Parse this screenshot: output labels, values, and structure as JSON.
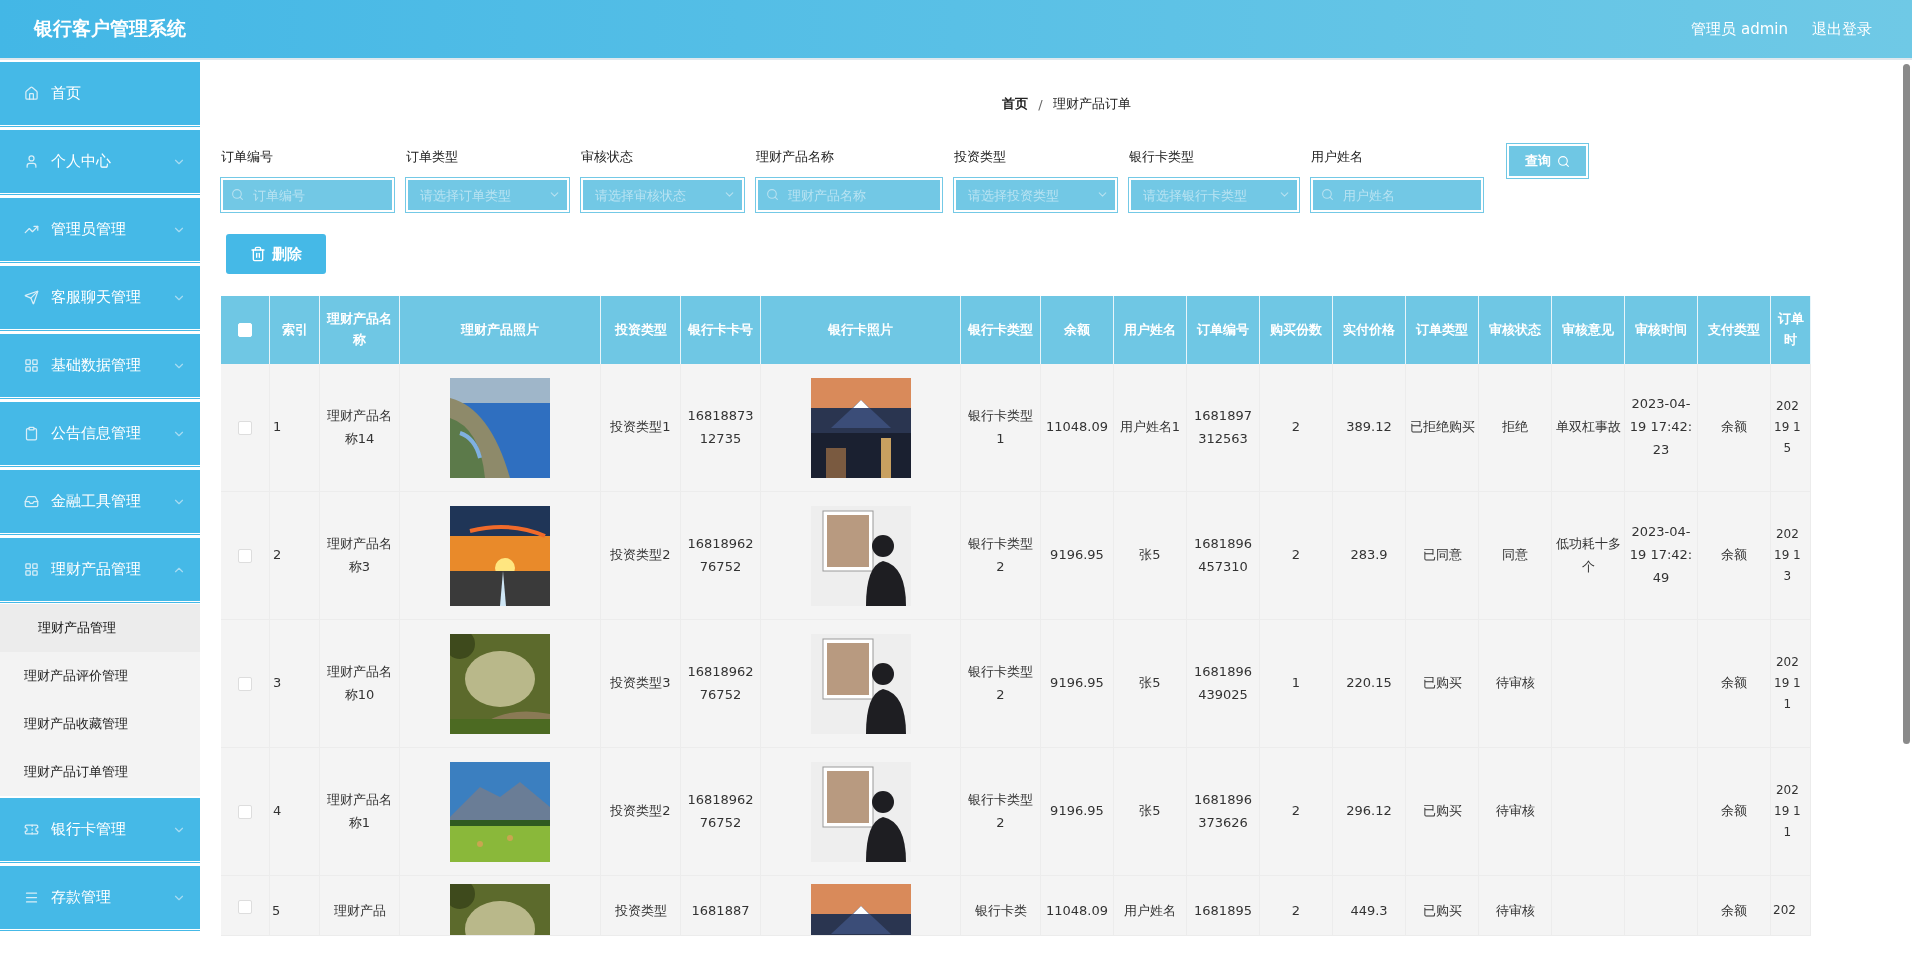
{
  "header": {
    "title": "银行客户管理系统",
    "user": "管理员 admin",
    "logout": "退出登录"
  },
  "sidebar": {
    "items": [
      {
        "label": "首页",
        "expandable": false
      },
      {
        "label": "个人中心",
        "expandable": true,
        "expanded": false
      },
      {
        "label": "管理员管理",
        "expandable": true,
        "expanded": false
      },
      {
        "label": "客服聊天管理",
        "expandable": true,
        "expanded": false
      },
      {
        "label": "基础数据管理",
        "expandable": true,
        "expanded": false
      },
      {
        "label": "公告信息管理",
        "expandable": true,
        "expanded": false
      },
      {
        "label": "金融工具管理",
        "expandable": true,
        "expanded": false
      },
      {
        "label": "理财产品管理",
        "expandable": true,
        "expanded": true,
        "children": [
          {
            "label": "理财产品管理",
            "selected": true
          },
          {
            "label": "理财产品评价管理",
            "selected": false
          },
          {
            "label": "理财产品收藏管理",
            "selected": false
          },
          {
            "label": "理财产品订单管理",
            "selected": false
          }
        ]
      },
      {
        "label": "银行卡管理",
        "expandable": true,
        "expanded": false
      },
      {
        "label": "存款管理",
        "expandable": true,
        "expanded": false
      }
    ]
  },
  "breadcrumb": {
    "items": [
      "首页",
      "理财产品订单"
    ],
    "separator": "/"
  },
  "filters": [
    {
      "label": "订单编号",
      "placeholder": "订单编号",
      "kind": "text"
    },
    {
      "label": "订单类型",
      "placeholder": "请选择订单类型",
      "kind": "select"
    },
    {
      "label": "审核状态",
      "placeholder": "请选择审核状态",
      "kind": "select"
    },
    {
      "label": "理财产品名称",
      "placeholder": "理财产品名称",
      "kind": "text"
    },
    {
      "label": "投资类型",
      "placeholder": "请选择投资类型",
      "kind": "select"
    },
    {
      "label": "银行卡类型",
      "placeholder": "请选择银行卡类型",
      "kind": "select"
    },
    {
      "label": "用户姓名",
      "placeholder": "用户姓名",
      "kind": "text"
    }
  ],
  "search_button": "查询",
  "delete_button": "删除",
  "table": {
    "select_all": {
      "checked": false
    },
    "columns": [
      {
        "label": "索引",
        "kind": "text"
      },
      {
        "label": "理财产品名称",
        "kind": "text"
      },
      {
        "label": "理财产品照片"
      },
      {
        "label": "投资类型",
        "kind": "text"
      },
      {
        "label": "银行卡卡号",
        "kind": "text"
      },
      {
        "label": "银行卡照片"
      },
      {
        "label": "银行卡类型",
        "kind": "text"
      },
      {
        "label": "余额",
        "kind": "text"
      },
      {
        "label": "用户姓名",
        "kind": "text"
      },
      {
        "label": "订单编号",
        "kind": "text"
      },
      {
        "label": "购买份数",
        "kind": "text"
      },
      {
        "label": "实付价格",
        "kind": "text"
      },
      {
        "label": "订单类型",
        "kind": "text"
      },
      {
        "label": "审核状态",
        "kind": "text"
      },
      {
        "label": "审核意见",
        "kind": "text"
      },
      {
        "label": "审核时间",
        "kind": "text"
      },
      {
        "label": "支付类型",
        "kind": "text"
      },
      {
        "label": "订单时",
        "kind": "cut"
      }
    ],
    "rows": [
      {
        "selected": false,
        "cells": [
          "1",
          "理财产品名称14",
          "",
          "投资类型1",
          "1681887312735",
          "",
          "银行卡类型1",
          "11048.09",
          "用户姓名1",
          "1681897312563",
          "2",
          "389.12",
          "已拒绝购买",
          "拒绝",
          "单双杠事故",
          "2023-04-19 17:42:23",
          "余额",
          "202\n19 1\n5"
        ]
      },
      {
        "selected": false,
        "cells": [
          "2",
          "理财产品名称3",
          "",
          "投资类型2",
          "1681896276752",
          "",
          "银行卡类型2",
          "9196.95",
          "张5",
          "1681896457310",
          "2",
          "283.9",
          "已同意",
          "同意",
          "低功耗十多个",
          "2023-04-19 17:42:49",
          "余额",
          "202\n19 1\n3"
        ]
      },
      {
        "selected": false,
        "cells": [
          "3",
          "理财产品名称10",
          "",
          "投资类型3",
          "1681896276752",
          "",
          "银行卡类型2",
          "9196.95",
          "张5",
          "1681896439025",
          "1",
          "220.15",
          "已购买",
          "待审核",
          "",
          "",
          "余额",
          "202\n19 1\n1"
        ]
      },
      {
        "selected": false,
        "cells": [
          "4",
          "理财产品名称1",
          "",
          "投资类型2",
          "1681896276752",
          "",
          "银行卡类型2",
          "9196.95",
          "张5",
          "1681896373626",
          "2",
          "296.12",
          "已购买",
          "待审核",
          "",
          "",
          "余额",
          "202\n19 1\n1"
        ]
      },
      {
        "selected": false,
        "cells": [
          "5",
          "理财产品",
          "",
          "投资类型",
          "1681887",
          "",
          "银行卡类",
          "11048.09",
          "用户姓名",
          "1681895",
          "2",
          "449.3",
          "已购买",
          "待审核",
          "",
          "",
          "余额",
          "202"
        ]
      }
    ]
  }
}
